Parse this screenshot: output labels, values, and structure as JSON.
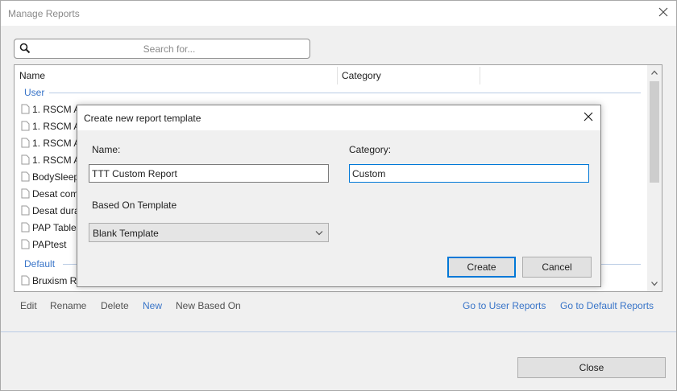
{
  "window": {
    "title": "Manage Reports"
  },
  "search": {
    "placeholder": "Search for..."
  },
  "list": {
    "columns": {
      "name": "Name",
      "category": "Category"
    },
    "groups": [
      {
        "label": "User"
      },
      {
        "label": "Default"
      }
    ],
    "user_rows": [
      {
        "label": "1. RSCM A"
      },
      {
        "label": "1. RSCM A"
      },
      {
        "label": "1. RSCM A"
      },
      {
        "label": "1. RSCM A"
      },
      {
        "label": "BodySleep"
      },
      {
        "label": "Desat com"
      },
      {
        "label": "Desat dura"
      },
      {
        "label": "PAP Table"
      },
      {
        "label": "PAPtest"
      }
    ],
    "default_rows": [
      {
        "label": "Bruxism R"
      }
    ]
  },
  "actions": {
    "edit": "Edit",
    "rename": "Rename",
    "delete": "Delete",
    "new": "New",
    "new_based_on": "New Based On",
    "go_user": "Go to User Reports",
    "go_default": "Go to Default Reports"
  },
  "footer": {
    "close_label": "Close"
  },
  "dialog": {
    "title": "Create new report template",
    "name_label": "Name:",
    "name_value": "TTT Custom Report",
    "category_label": "Category:",
    "category_value": "Custom",
    "template_label": "Based On Template",
    "template_value": "Blank Template",
    "create_label": "Create",
    "cancel_label": "Cancel"
  },
  "icons": {
    "window_close": "close-icon",
    "search": "search-icon",
    "row": "document-icon",
    "dropdown": "chevron-down-icon"
  },
  "colors": {
    "accent": "#3874c8",
    "focus": "#0078d7"
  }
}
